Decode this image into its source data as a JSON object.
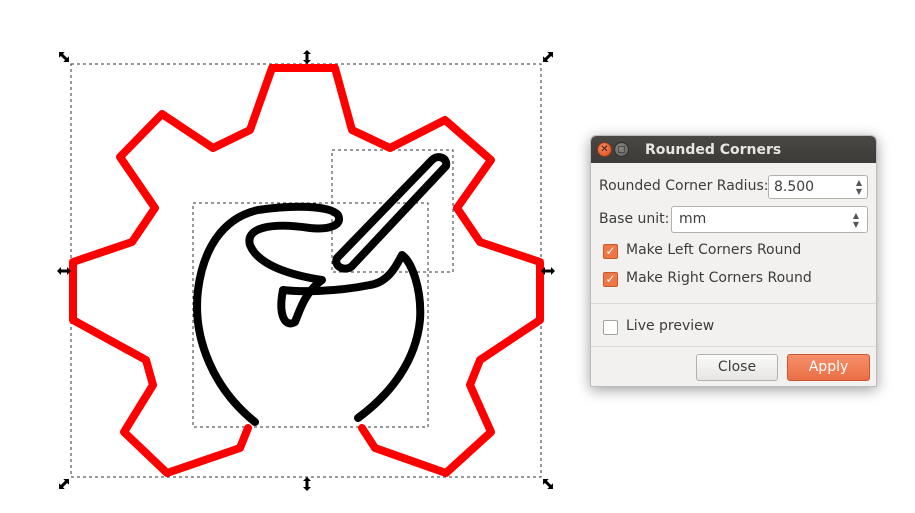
{
  "dialog": {
    "title": "Rounded Corners",
    "radius_label": "Rounded Corner Radius:",
    "radius_value": "8.500",
    "base_unit_label": "Base unit:",
    "base_unit_value": "mm",
    "left_corners_label": "Make Left Corners Round",
    "left_corners_checked": true,
    "right_corners_label": "Make Right Corners Round",
    "right_corners_checked": true,
    "live_preview_label": "Live preview",
    "live_preview_checked": false,
    "close_label": "Close",
    "apply_label": "Apply"
  },
  "colors": {
    "gear_stroke": "#ff0000",
    "icon_stroke": "#000000",
    "accent": "#ef7746",
    "titlebar": "#3c3b37"
  }
}
